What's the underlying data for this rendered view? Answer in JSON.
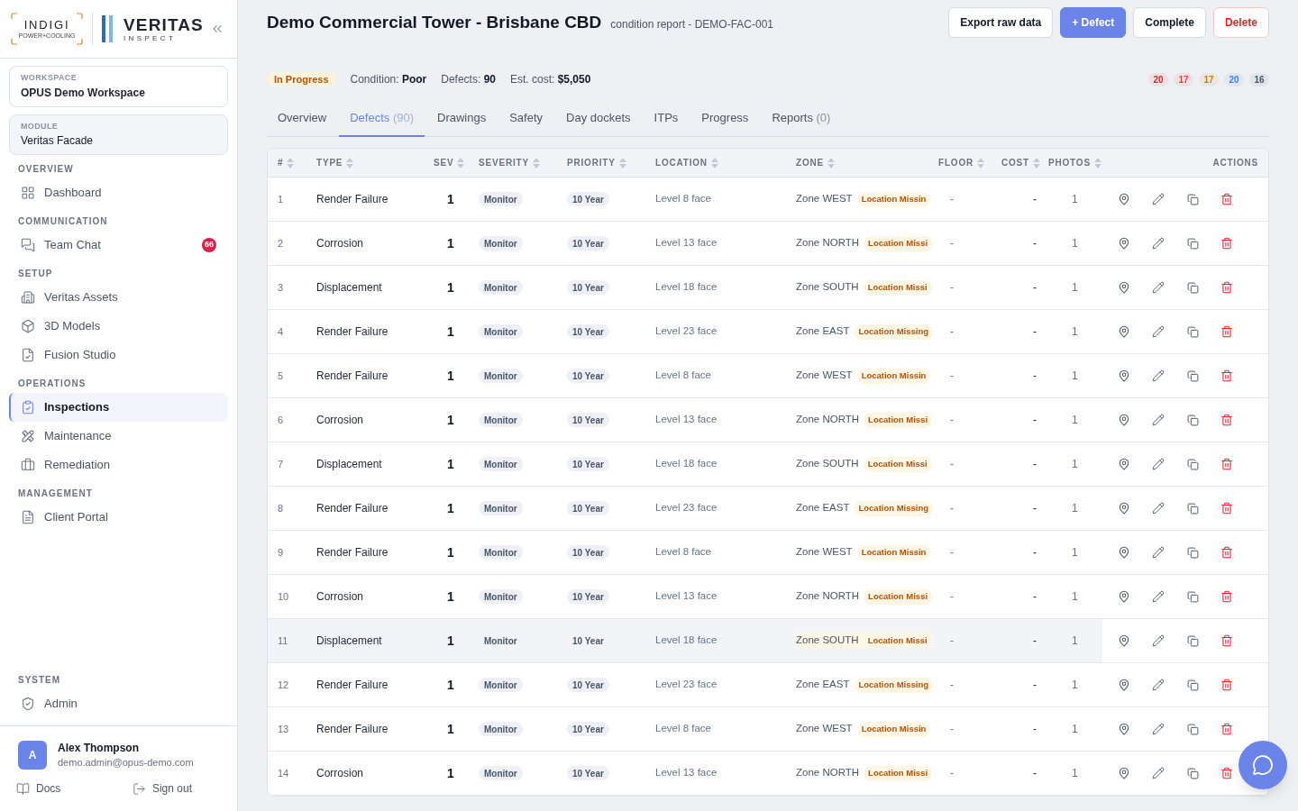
{
  "sidebar": {
    "logo": {
      "brand": "INDIGI",
      "tagline": "POWER+COOLING",
      "product": "VERITAS",
      "product_sub": "INSPECT"
    },
    "workspace": {
      "label": "WORKSPACE",
      "value": "OPUS Demo Workspace"
    },
    "module": {
      "label": "MODULE",
      "value": "Veritas Facade"
    },
    "sections": [
      {
        "heading": "OVERVIEW",
        "items": [
          {
            "label": "Dashboard",
            "selected": false
          }
        ]
      },
      {
        "heading": "COMMUNICATION",
        "items": [
          {
            "label": "Team Chat",
            "selected": false,
            "badge": "66"
          }
        ]
      },
      {
        "heading": "SETUP",
        "items": [
          {
            "label": "Veritas Assets",
            "selected": false
          },
          {
            "label": "3D Models",
            "selected": false
          },
          {
            "label": "Fusion Studio",
            "selected": false
          }
        ]
      },
      {
        "heading": "OPERATIONS",
        "items": [
          {
            "label": "Inspections",
            "selected": true
          },
          {
            "label": "Maintenance",
            "selected": false
          },
          {
            "label": "Remediation",
            "selected": false
          }
        ]
      },
      {
        "heading": "MANAGEMENT",
        "items": [
          {
            "label": "Client Portal",
            "selected": false
          }
        ]
      }
    ],
    "bottom_sections": [
      {
        "heading": "SYSTEM",
        "items": [
          {
            "label": "Admin",
            "selected": false
          }
        ]
      }
    ],
    "user": {
      "initial": "A",
      "name": "Alex Thompson",
      "email": "demo.admin@opus-demo.com"
    },
    "footer_links": [
      "Docs",
      "Sign out"
    ]
  },
  "header": {
    "title": "Demo Commercial Tower - Brisbane CBD",
    "subtitle": "condition report - DEMO-FAC-001",
    "buttons": [
      {
        "label": "Export raw data",
        "kind": "outline"
      },
      {
        "label": "+ Defect",
        "kind": "primary"
      },
      {
        "label": "Complete",
        "kind": "outline"
      },
      {
        "label": "Delete",
        "kind": "danger"
      }
    ]
  },
  "summary": {
    "status": "In Progress",
    "stats": [
      {
        "label": "Condition:",
        "value": "Poor"
      },
      {
        "label": "Defects:",
        "value": "90"
      },
      {
        "label": "Est. cost:",
        "value": "$5,050"
      }
    ],
    "severity_counts": [
      {
        "value": "20",
        "color": "#dc2626"
      },
      {
        "value": "17",
        "color": "#ef4444"
      },
      {
        "value": "17",
        "color": "#d97706"
      },
      {
        "value": "20",
        "color": "#3b82f6"
      },
      {
        "value": "16",
        "color": "#475569"
      }
    ]
  },
  "tabs": [
    {
      "label": "Overview",
      "selected": false
    },
    {
      "label": "Defects",
      "count": "(90)",
      "selected": true
    },
    {
      "label": "Drawings",
      "selected": false
    },
    {
      "label": "Safety",
      "selected": false
    },
    {
      "label": "Day dockets",
      "selected": false
    },
    {
      "label": "ITPs",
      "selected": false
    },
    {
      "label": "Progress",
      "selected": false
    },
    {
      "label": "Reports",
      "count": "(0)",
      "selected": false
    }
  ],
  "table": {
    "columns": [
      {
        "label": "#",
        "sortable": true
      },
      {
        "label": "TYPE",
        "sortable": true
      },
      {
        "label": "SEV",
        "sortable": true
      },
      {
        "label": "SEVERITY",
        "sortable": true
      },
      {
        "label": "PRIORITY",
        "sortable": true
      },
      {
        "label": "LOCATION",
        "sortable": true
      },
      {
        "label": "ZONE",
        "sortable": true
      },
      {
        "label": "FLOOR",
        "sortable": true
      },
      {
        "label": "COST",
        "sortable": true
      },
      {
        "label": "PHOTOS",
        "sortable": true
      },
      {
        "label": "ACTIONS",
        "sortable": false
      }
    ],
    "rows": [
      {
        "no": "1",
        "type": "Render Failure",
        "sev": "1",
        "severity": "Monitor",
        "priority": "10 Year",
        "location": "Level 8 face",
        "zone": "Zone WEST",
        "zone_flag": "Location Missin",
        "floor": "-",
        "cost": "-",
        "photos": "1",
        "highlighted": false
      },
      {
        "no": "2",
        "type": "Corrosion",
        "sev": "1",
        "severity": "Monitor",
        "priority": "10 Year",
        "location": "Level 13 face",
        "zone": "Zone NORTH",
        "zone_flag": "Location Missi",
        "floor": "-",
        "cost": "-",
        "photos": "1",
        "highlighted": false
      },
      {
        "no": "3",
        "type": "Displacement",
        "sev": "1",
        "severity": "Monitor",
        "priority": "10 Year",
        "location": "Level 18 face",
        "zone": "Zone SOUTH",
        "zone_flag": "Location Missi",
        "floor": "-",
        "cost": "-",
        "photos": "1",
        "highlighted": false
      },
      {
        "no": "4",
        "type": "Render Failure",
        "sev": "1",
        "severity": "Monitor",
        "priority": "10 Year",
        "location": "Level 23 face",
        "zone": "Zone EAST",
        "zone_flag": "Location Missing",
        "floor": "-",
        "cost": "-",
        "photos": "1",
        "highlighted": false
      },
      {
        "no": "5",
        "type": "Render Failure",
        "sev": "1",
        "severity": "Monitor",
        "priority": "10 Year",
        "location": "Level 8 face",
        "zone": "Zone WEST",
        "zone_flag": "Location Missin",
        "floor": "-",
        "cost": "-",
        "photos": "1",
        "highlighted": false
      },
      {
        "no": "6",
        "type": "Corrosion",
        "sev": "1",
        "severity": "Monitor",
        "priority": "10 Year",
        "location": "Level 13 face",
        "zone": "Zone NORTH",
        "zone_flag": "Location Missi",
        "floor": "-",
        "cost": "-",
        "photos": "1",
        "highlighted": false
      },
      {
        "no": "7",
        "type": "Displacement",
        "sev": "1",
        "severity": "Monitor",
        "priority": "10 Year",
        "location": "Level 18 face",
        "zone": "Zone SOUTH",
        "zone_flag": "Location Missi",
        "floor": "-",
        "cost": "-",
        "photos": "1",
        "highlighted": false
      },
      {
        "no": "8",
        "type": "Render Failure",
        "sev": "1",
        "severity": "Monitor",
        "priority": "10 Year",
        "location": "Level 23 face",
        "zone": "Zone EAST",
        "zone_flag": "Location Missing",
        "floor": "-",
        "cost": "-",
        "photos": "1",
        "highlighted": false
      },
      {
        "no": "9",
        "type": "Render Failure",
        "sev": "1",
        "severity": "Monitor",
        "priority": "10 Year",
        "location": "Level 8 face",
        "zone": "Zone WEST",
        "zone_flag": "Location Missin",
        "floor": "-",
        "cost": "-",
        "photos": "1",
        "highlighted": false
      },
      {
        "no": "10",
        "type": "Corrosion",
        "sev": "1",
        "severity": "Monitor",
        "priority": "10 Year",
        "location": "Level 13 face",
        "zone": "Zone NORTH",
        "zone_flag": "Location Missi",
        "floor": "-",
        "cost": "-",
        "photos": "1",
        "highlighted": false
      },
      {
        "no": "11",
        "type": "Displacement",
        "sev": "1",
        "severity": "Monitor",
        "priority": "10 Year",
        "location": "Level 18 face",
        "zone": "Zone SOUTH",
        "zone_flag": "Location Missi",
        "floor": "-",
        "cost": "-",
        "photos": "1",
        "highlighted": true
      },
      {
        "no": "12",
        "type": "Render Failure",
        "sev": "1",
        "severity": "Monitor",
        "priority": "10 Year",
        "location": "Level 23 face",
        "zone": "Zone EAST",
        "zone_flag": "Location Missing",
        "floor": "-",
        "cost": "-",
        "photos": "1",
        "highlighted": false
      },
      {
        "no": "13",
        "type": "Render Failure",
        "sev": "1",
        "severity": "Monitor",
        "priority": "10 Year",
        "location": "Level 8 face",
        "zone": "Zone WEST",
        "zone_flag": "Location Missin",
        "floor": "-",
        "cost": "-",
        "photos": "1",
        "highlighted": false
      },
      {
        "no": "14",
        "type": "Corrosion",
        "sev": "1",
        "severity": "Monitor",
        "priority": "10 Year",
        "location": "Level 13 face",
        "zone": "Zone NORTH",
        "zone_flag": "Location Missi",
        "floor": "-",
        "cost": "-",
        "photos": "1",
        "highlighted": false
      }
    ]
  }
}
